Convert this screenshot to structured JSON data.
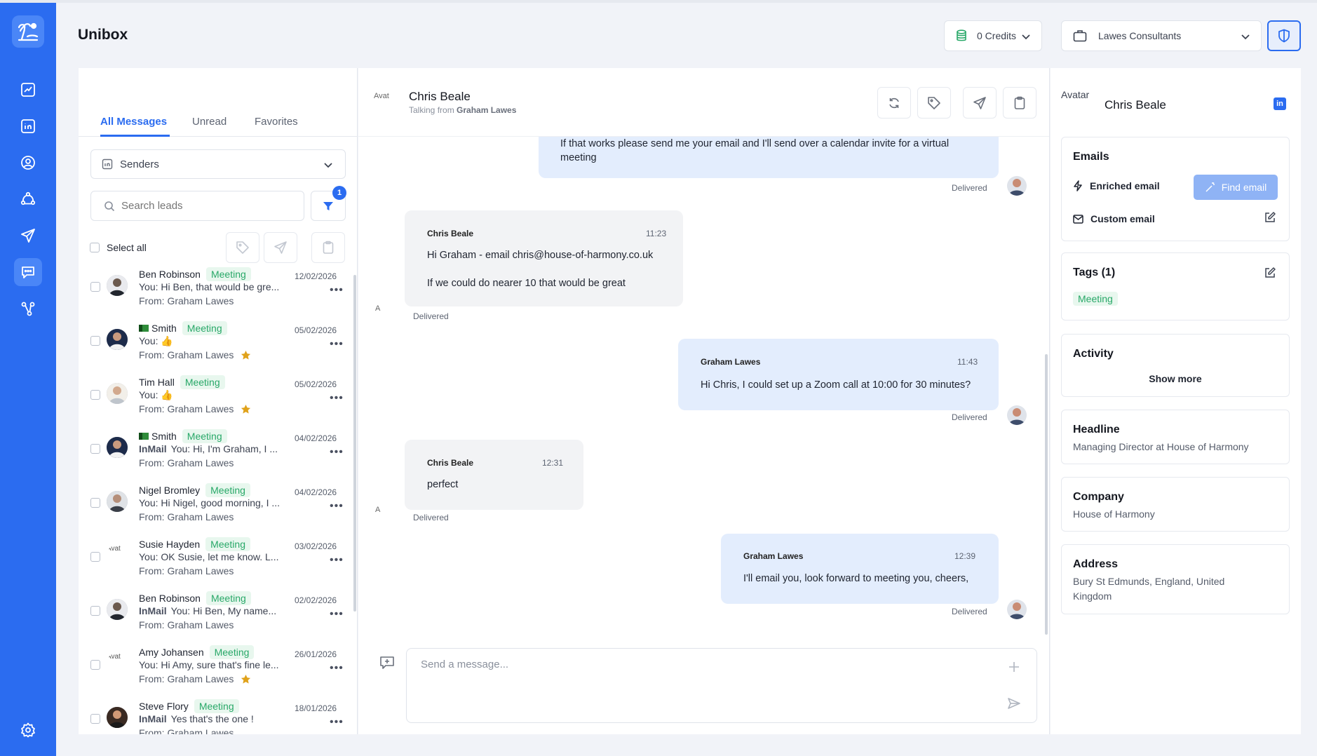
{
  "app": {
    "title": "Unibox"
  },
  "header": {
    "credits_label": "0 Credits",
    "company_label": "Lawes Consultants"
  },
  "colors": {
    "primary": "#2b6cf0",
    "tag_bg": "#e8f7ee",
    "tag_text": "#28a868",
    "bubble_out": "#e3edfd",
    "bubble_in": "#f2f3f5"
  },
  "rail": {
    "icons": [
      "island-logo-icon",
      "analytics-icon",
      "linkedin-icon",
      "user-circle-icon",
      "network-icon",
      "send-icon",
      "chat-icon",
      "integrations-icon",
      "settings-icon"
    ]
  },
  "list": {
    "tabs": [
      {
        "label": "All Messages"
      },
      {
        "label": "Unread"
      },
      {
        "label": "Favorites"
      }
    ],
    "senders_label": "Senders",
    "search_placeholder": "Search leads",
    "filter_count": "1",
    "select_all_label": "Select all",
    "conversations": [
      {
        "name": "Ben Robinson",
        "tag": "Meeting",
        "inmail": "",
        "preview": "You: Hi Ben, that would be gre...",
        "from": "From: Graham Lawes",
        "date": "12/02/2026",
        "starred": false,
        "flag": false
      },
      {
        "name": "Smith",
        "tag": "Meeting",
        "inmail": "",
        "preview": "You: 👍",
        "from": "From: Graham Lawes",
        "date": "05/02/2026",
        "starred": true,
        "flag": true
      },
      {
        "name": "Tim Hall",
        "tag": "Meeting",
        "inmail": "",
        "preview": "You: 👍",
        "from": "From: Graham Lawes",
        "date": "05/02/2026",
        "starred": true,
        "flag": false
      },
      {
        "name": "Smith",
        "tag": "Meeting",
        "inmail": "InMail",
        "preview": "You: Hi, I'm Graham, I ...",
        "from": "From: Graham Lawes",
        "date": "04/02/2026",
        "starred": false,
        "flag": true
      },
      {
        "name": "Nigel Bromley",
        "tag": "Meeting",
        "inmail": "",
        "preview": "You: Hi Nigel, good morning, I ...",
        "from": "From: Graham Lawes",
        "date": "04/02/2026",
        "starred": false,
        "flag": false
      },
      {
        "name": "Susie Hayden",
        "tag": "Meeting",
        "inmail": "",
        "preview": "You: OK Susie, let me know. L...",
        "from": "From: Graham Lawes",
        "date": "03/02/2026",
        "starred": false,
        "flag": false
      },
      {
        "name": "Ben Robinson",
        "tag": "Meeting",
        "inmail": "InMail",
        "preview": "You: Hi Ben, My name...",
        "from": "From: Graham Lawes",
        "date": "02/02/2026",
        "starred": false,
        "flag": false
      },
      {
        "name": "Amy Johansen",
        "tag": "Meeting",
        "inmail": "",
        "preview": "You: Hi Amy, sure that's fine le...",
        "from": "From: Graham Lawes",
        "date": "26/01/2026",
        "starred": true,
        "flag": false
      },
      {
        "name": "Steve Flory",
        "tag": "Meeting",
        "inmail": "InMail",
        "preview": "Yes that's the one !",
        "from": "From: Graham Lawes",
        "date": "18/01/2026",
        "starred": false,
        "flag": false
      }
    ]
  },
  "chat": {
    "contact_name": "Chris Beale",
    "talking_from_prefix": "Talking from",
    "talking_from_name": "Graham Lawes",
    "avatar_alt": "Avat",
    "messages": [
      {
        "sender": "",
        "time": "",
        "text": "If that works please send me your email and I'll send over a calendar invite for a virtual meeting",
        "text2": "",
        "status": "Delivered"
      },
      {
        "sender": "Chris Beale",
        "time": "11:23",
        "text": "Hi Graham - email chris@house-of-harmony.co.uk",
        "text2": "If we could do nearer 10 that would be great",
        "status": "Delivered"
      },
      {
        "sender": "Graham Lawes",
        "time": "11:43",
        "text": "Hi Chris, I could set up a Zoom call at 10:00 for 30 minutes?",
        "text2": "",
        "status": "Delivered"
      },
      {
        "sender": "Chris Beale",
        "time": "12:31",
        "text": "perfect",
        "text2": "",
        "status": "Delivered"
      },
      {
        "sender": "Graham Lawes",
        "time": "12:39",
        "text": "I'll email you, look forward to meeting you, cheers,",
        "text2": "",
        "status": "Delivered"
      }
    ],
    "composer_placeholder": "Send a message..."
  },
  "info": {
    "avatar_alt": "Avatar",
    "name": "Chris Beale",
    "linkedin_label": "in",
    "emails_title": "Emails",
    "enriched_label": "Enriched email",
    "find_email_label": "Find email",
    "custom_label": "Custom email",
    "tags_title": "Tags (1)",
    "tag": "Meeting",
    "activity_title": "Activity",
    "show_more": "Show more",
    "headline_title": "Headline",
    "headline": "Managing Director at House of Harmony",
    "company_title": "Company",
    "company": "House of Harmony",
    "address_title": "Address",
    "address": "Bury St Edmunds, England, United Kingdom"
  }
}
